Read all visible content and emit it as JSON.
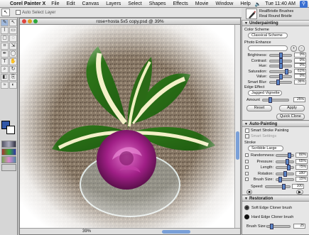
{
  "menubar": {
    "apple": "",
    "app_name": "Corel Painter X",
    "items": [
      "File",
      "Edit",
      "Canvas",
      "Layers",
      "Select",
      "Shapes",
      "Effects",
      "Movie",
      "Window",
      "Help"
    ],
    "clock": "Tue 11:40 AM",
    "spotlight_icon": "spotlight-icon"
  },
  "propbar": {
    "auto_select_layer": "Auto Select Layer"
  },
  "brush_selector": {
    "category": "RealBristle Brushes",
    "variant": "Real Round Bristle"
  },
  "document": {
    "title": "rose+hosta 5x5 copy.psd @ 39%",
    "zoom": "39%"
  },
  "underpainting": {
    "title": "Underpainting",
    "color_scheme_label": "Color Scheme",
    "color_scheme_value": "Classical Scheme",
    "photo_enhance_label": "Photo Enhance",
    "photo_enhance_value": "",
    "sliders": [
      {
        "label": "Brightness:",
        "value": "0%",
        "pos": 0.5
      },
      {
        "label": "Contrast:",
        "value": "0%",
        "pos": 0.5
      },
      {
        "label": "Hue:",
        "value": "0%",
        "pos": 0.5
      },
      {
        "label": "Saturation:",
        "value": "61%",
        "pos": 0.8
      },
      {
        "label": "Value:",
        "value": "0%",
        "pos": 0.5
      },
      {
        "label": "Smart Blur:",
        "value": "36%",
        "pos": 0.36
      }
    ],
    "edge_effect_label": "Edge Effect",
    "edge_effect_value": "Jagged Vignette",
    "amount_label": "Amount",
    "amount_value": "25%",
    "amount_pos": 0.25,
    "reset": "Reset",
    "apply": "Apply",
    "quick_clone": "Quick Clone"
  },
  "auto_painting": {
    "title": "Auto-Painting",
    "smart_stroke_painting": "Smart Stroke Painting",
    "smart_settings": "Smart Settings",
    "stroke_label": "Stroke",
    "stroke_value": "Scribble Large",
    "sliders": [
      {
        "label": "Randomness:",
        "value": "80%",
        "pos": 0.8
      },
      {
        "label": "Pressure:",
        "value": "65%",
        "pos": 0.65
      },
      {
        "label": "Length:",
        "value": "75%",
        "pos": 0.75
      },
      {
        "label": "Rotation:",
        "value": "180°",
        "pos": 0.5
      },
      {
        "label": "Brush Size:",
        "value": "15%",
        "pos": 0.15
      }
    ],
    "speed_label": "Speed:",
    "speed_value": "100",
    "speed_pos": 0.75
  },
  "restoration": {
    "title": "Restoration",
    "soft_brush": "Soft Edge Cloner brush",
    "hard_brush": "Hard Edge Cloner brush",
    "brush_size_label": "Brush Size:",
    "brush_size_value": "25"
  },
  "colors": {
    "accent": "#5a86c8",
    "foreground_swatch": "#3157a8"
  }
}
